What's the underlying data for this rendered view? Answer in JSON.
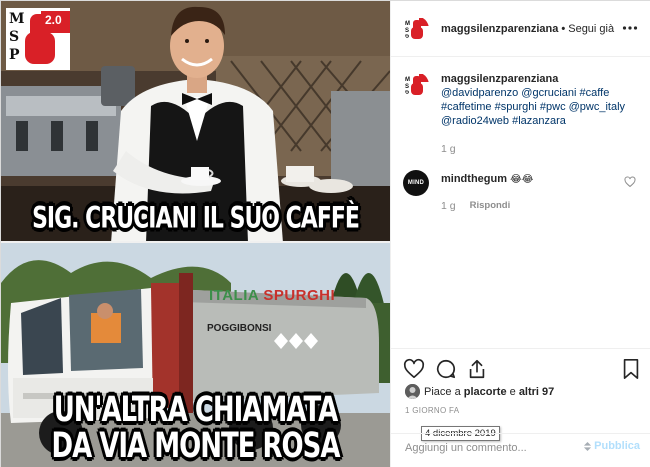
{
  "post": {
    "image": {
      "meme_top": "SIG. CRUCIANI IL SUO CAFFÈ",
      "meme_bottom_line1": "UN'ALTRA CHIAMATA",
      "meme_bottom_line2": "DA VIA MONTE ROSA",
      "logo_letters": [
        "M",
        "S",
        "P"
      ],
      "logo_version": "2.0",
      "truck_brand_1": "ITALIA",
      "truck_brand_2": "SPURGHI",
      "truck_city": "POGGIBONSI"
    },
    "header": {
      "username": "maggsilenzparenziana",
      "separator": "•",
      "follow_label": "Segui già",
      "more_icon": "more-horizontal-icon"
    },
    "caption": {
      "username": "maggsilenzparenziana",
      "tags": [
        "@davidparenzo",
        "@gcruciani",
        "#caffe",
        "#caffetime",
        "#spurghi",
        "#pwc",
        "@pwc_italy",
        "@radio24web",
        "#lazanzara"
      ],
      "time": "1 g"
    },
    "comment": {
      "username": "mindthegum",
      "emoji": "😂😂",
      "time": "1 g",
      "reply_label": "Rispondi",
      "avatar_text": "MIND"
    },
    "actions": {
      "like_icon": "heart-icon",
      "comment_icon": "comment-icon",
      "share_icon": "share-icon",
      "save_icon": "bookmark-icon"
    },
    "likes": {
      "prefix": "Piace a",
      "user": "placorte",
      "conj": "e",
      "others": "altri 97"
    },
    "timestamp": "1 giorno fa",
    "tooltip": "4 dicembre 2019",
    "add_comment": {
      "placeholder": "Aggiungi un commento...",
      "publish_label": "Pubblica"
    },
    "colors": {
      "accent_link": "#003569",
      "publish_disabled": "#b2dffc",
      "logo_red": "#d92027"
    }
  }
}
